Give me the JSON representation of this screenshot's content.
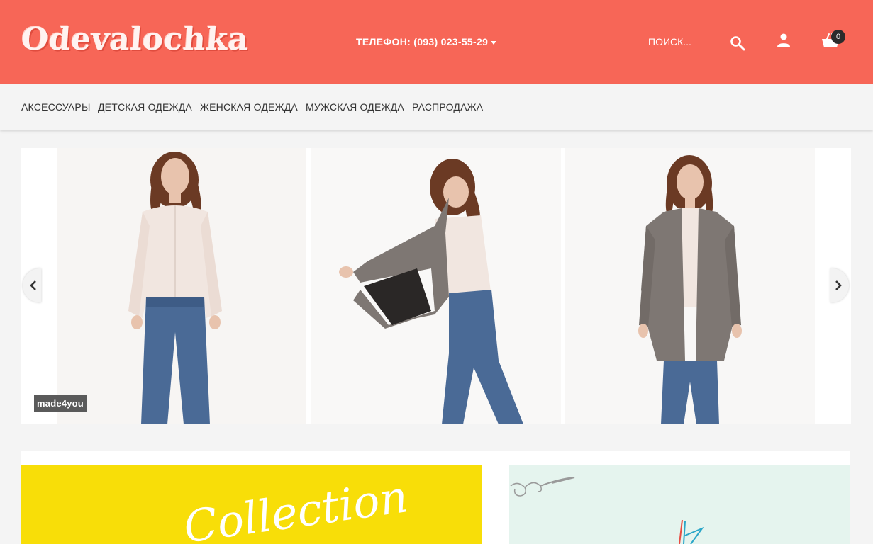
{
  "header": {
    "logo": "Odevalochka",
    "phone": "ТЕЛЕФОН: (093) 023-55-29",
    "search_placeholder": "ПОИСК...",
    "cart_count": "0"
  },
  "nav": {
    "items": [
      "АКСЕССУАРЫ",
      "ДЕТСКАЯ ОДЕЖДА",
      "ЖЕНСКАЯ ОДЕЖДА",
      "МУЖСКАЯ ОДЕЖДА",
      "РАСПРОДАЖА"
    ]
  },
  "slider": {
    "caption": "made4you"
  },
  "banners": {
    "yellow_text": "Collection"
  },
  "colors": {
    "header_bg": "#f76657",
    "nav_bg": "#f4f4f4",
    "yellow_banner": "#f8de08",
    "mint_banner": "#e5f4ee"
  },
  "icons": [
    "search-icon",
    "user-icon",
    "cart-icon",
    "chevron-left-icon",
    "chevron-right-icon",
    "caret-down-icon"
  ]
}
